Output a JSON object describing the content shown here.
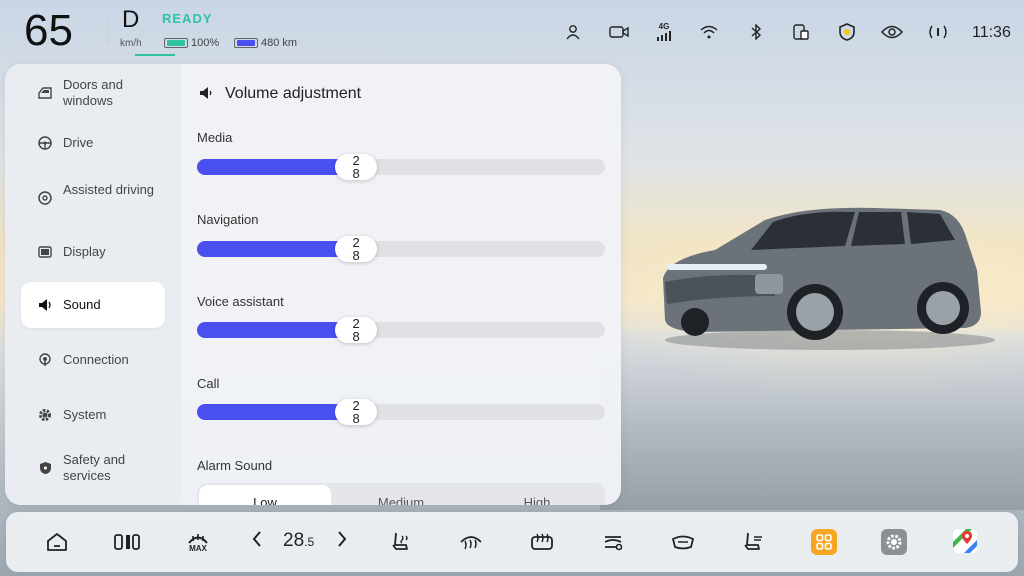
{
  "status": {
    "speed": "65",
    "speed_unit": "km/h",
    "gear": "D",
    "ready": "READY",
    "battery_percent": "100%",
    "range": "480 km",
    "time": "11:36",
    "network": "4G",
    "icons": [
      "driver-profile-icon",
      "camera-icon",
      "signal-4g-icon",
      "wifi-icon",
      "bluetooth-icon",
      "phone-projection-icon",
      "security-shield-icon",
      "privacy-eye-icon",
      "broadcast-icon"
    ],
    "colors": {
      "ready": "#2ec4a0",
      "battery": "#2ec4a0",
      "range": "#4a4ff0"
    }
  },
  "sidebar": {
    "items": [
      {
        "label": "Doors and windows",
        "icon": "car-door-icon"
      },
      {
        "label": "Drive",
        "icon": "steering-wheel-icon"
      },
      {
        "label": "Assisted driving",
        "icon": "assisted-driving-icon"
      },
      {
        "label": "Display",
        "icon": "display-icon"
      },
      {
        "label": "Sound",
        "icon": "speaker-icon",
        "active": true
      },
      {
        "label": "Connection",
        "icon": "connection-icon"
      },
      {
        "label": "System",
        "icon": "gear-icon"
      },
      {
        "label": "Safety and services",
        "icon": "shield-icon"
      }
    ]
  },
  "sound": {
    "title": "Volume adjustment",
    "sliders": [
      {
        "label": "Media",
        "value": "28",
        "fraction": 0.39
      },
      {
        "label": "Navigation",
        "value": "28",
        "fraction": 0.39
      },
      {
        "label": "Voice assistant",
        "value": "28",
        "fraction": 0.39
      },
      {
        "label": "Call",
        "value": "28",
        "fraction": 0.39
      }
    ],
    "alarm_label": "Alarm Sound",
    "alarm_options": [
      "Low",
      "Medium",
      "High"
    ],
    "alarm_selected": "Low",
    "accent": "#4a4ff0"
  },
  "dock": {
    "temperature": "28",
    "temperature_decimal": ".5",
    "defrost_label": "MAX",
    "icons": [
      "home-icon",
      "climate-columns-icon",
      "max-defrost-icon",
      "temp-down-arrow-icon",
      "temp-up-arrow-icon",
      "seat-heat-icon",
      "front-defrost-icon",
      "rear-defrost-icon",
      "fan-mode-icon",
      "steering-heat-icon",
      "seat-ventilation-icon",
      "apps-icon",
      "settings-icon",
      "maps-icon"
    ],
    "apps_color": "#f5a623"
  }
}
